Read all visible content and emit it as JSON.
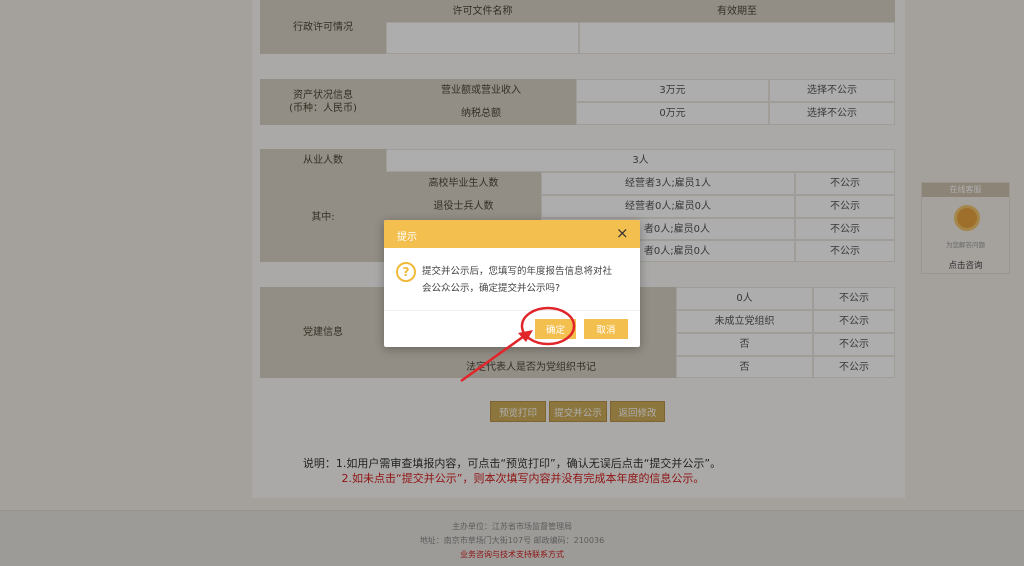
{
  "permit": {
    "section": "行政许可情况",
    "col_name": "许可文件名称",
    "col_valid": "有效期至"
  },
  "assets": {
    "section_line1": "资产状况信息",
    "section_line2": "(币种：人民币)",
    "rows": [
      {
        "label": "营业额或营业收入",
        "value": "3万元",
        "visibility": "选择不公示"
      },
      {
        "label": "纳税总额",
        "value": "0万元",
        "visibility": "选择不公示"
      }
    ]
  },
  "employees": {
    "label": "从业人数",
    "value": "3人",
    "among": "其中:",
    "rows": [
      {
        "label": "高校毕业生人数",
        "value": "经营者3人;雇员1人",
        "visibility": "不公示"
      },
      {
        "label": "退役士兵人数",
        "value": "经营者0人;雇员0人",
        "visibility": "不公示"
      },
      {
        "label": "",
        "value": "者0人;雇员0人",
        "visibility": "不公示"
      },
      {
        "label": "",
        "value": "者0人;雇员0人",
        "visibility": "不公示"
      }
    ]
  },
  "party": {
    "section": "党建信息",
    "rows": [
      {
        "label": "",
        "value": "0人",
        "visibility": "不公示"
      },
      {
        "label": "",
        "value": "未成立党组织",
        "visibility": "不公示"
      },
      {
        "label": "",
        "value": "否",
        "visibility": "不公示"
      },
      {
        "label": "法定代表人是否为党组织书记",
        "value": "否",
        "visibility": "不公示"
      }
    ]
  },
  "actions": {
    "preview": "预览打印",
    "submit": "提交并公示",
    "back": "返回修改"
  },
  "notes": {
    "line1": "说明：1.如用户需审查填报内容，可点击“预览打印”，确认无误后点击“提交并公示”。",
    "line2": "2.如未点击“提交并公示”，则本次填写内容并没有完成本年度的信息公示。"
  },
  "footer": {
    "sponsor": "主办单位：江苏省市场监督管理局",
    "address": "地址：南京市草场门大街107号    邮政编码：210036",
    "contact": "业务咨询与技术支持联系方式"
  },
  "online_service": {
    "title": "在线客服",
    "avatar_caption": "为您解答问题",
    "action": "点击咨询"
  },
  "dialog": {
    "title": "提示",
    "message_line1": "提交并公示后，您填写的年度报告信息将对社",
    "message_line2": "会公众公示，确定提交并公示吗?",
    "confirm": "确定",
    "cancel": "取消",
    "close_glyph": "×",
    "question_glyph": "?"
  },
  "colors": {
    "header_cell": "#d9d1c4",
    "dialog_header": "#f3bf4e",
    "button": "#f3bf4e",
    "annotation": "#e0262a",
    "note_red": "#d42020"
  },
  "icons": [
    "question-icon",
    "close-icon",
    "customer-service-avatar-icon",
    "annotation-arrow"
  ]
}
